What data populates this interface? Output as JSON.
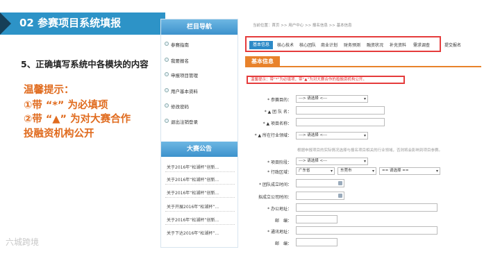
{
  "slide": {
    "header_title": "02 参赛项目系统填报",
    "subtitle": "5、正确填写系统中各模块的内容",
    "tip_line1": "温馨提示：",
    "tip_line2": "①带 “*” 为必填项",
    "tip_line3": "②带 “▲” 为对大赛合作",
    "tip_line4": "投融资机构公开",
    "watermark": "六城跨境",
    "colors": {
      "header_bg": "#2d93c7",
      "accent": "#e8822b",
      "highlight": "#e53b3b"
    }
  },
  "sidebar": {
    "nav_title": "栏目导航",
    "nav_items": [
      "参赛指南",
      "我要报名",
      "申报项目管理",
      "用户基本资料",
      "修改密码",
      "退出注销登录"
    ],
    "ann_title": "大赛公告",
    "ann_items": [
      "关于2016年“松湖杯”创新...",
      "关于2016年“松湖杯”创新...",
      "关于2016年“松湖杯”创新...",
      "关于开展2016年“松湖杯”...",
      "关于2016年“松湖杯”创新...",
      "关于下达2016年“松湖杯”..."
    ]
  },
  "main": {
    "breadcrumb": "当前位置：首页 >> 用户中心 >> 报名信息 >> 基本信息",
    "tabs": [
      "基本信息",
      "核心技术",
      "核心团队",
      "商业计划",
      "财务预测",
      "融资状况",
      "补充资料",
      "需求调查",
      "提交报名"
    ],
    "section_title": "基本信息",
    "notice": "温馨提示：带“*”为必填项，带“▲”为对大赛合作的投融资机构公开。",
    "fields": {
      "goal": "* 参赛目的：",
      "team": "* ▲ 团 队 名：",
      "project": "* ▲ 项目名称：",
      "industry": "* ▲ 所在行业领域：",
      "stage": "* 项目阶段：",
      "region": "* 行政区域：",
      "team_date": "* 团队成立时间：",
      "company_date": "拟成立公司时间：",
      "office_addr": "* 办公地址：",
      "zip1": "邮　编：",
      "mail_addr": "* 通讯地址：",
      "zip2": "邮　编："
    },
    "select_placeholder": "---> 请选择 <---",
    "province": "广东省",
    "city": "东莞市",
    "district": "== 请选择 ==",
    "industry_hint": "根据申报项目的实际情况选择与报名项目相关的行业领域，否则将会影响到项目参赛。"
  }
}
